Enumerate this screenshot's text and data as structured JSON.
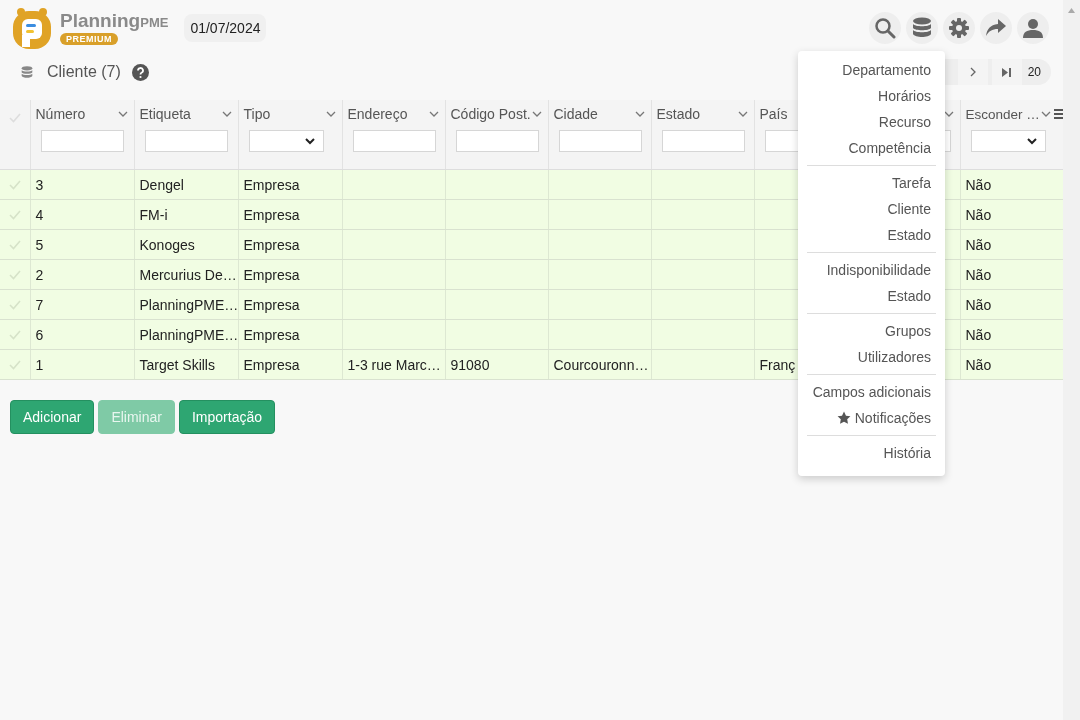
{
  "logo": {
    "name": "Planning",
    "suffix": "PME",
    "badge": "PREMIUM"
  },
  "date": "01/07/2024",
  "title": {
    "text": "Cliente (7)"
  },
  "pagination": {
    "page_size": "20"
  },
  "table": {
    "columns": [
      {
        "label": "Número",
        "kind": "text",
        "chevron": true
      },
      {
        "label": "Etiqueta",
        "kind": "text",
        "chevron": true
      },
      {
        "label": "Tipo",
        "kind": "select",
        "chevron": true
      },
      {
        "label": "Endereço",
        "kind": "text",
        "chevron": true
      },
      {
        "label": "Código Post.",
        "kind": "text",
        "chevron": true
      },
      {
        "label": "Cidade",
        "kind": "text",
        "chevron": true
      },
      {
        "label": "Estado",
        "kind": "text",
        "chevron": true
      },
      {
        "label": "País",
        "kind": "text",
        "chevron": false
      },
      {
        "kind": "text",
        "chevron": true
      },
      {
        "label": "Esconder …",
        "kind": "select",
        "chevron": true
      }
    ],
    "rows": [
      [
        "3",
        "Dengel",
        "Empresa",
        "",
        "",
        "",
        "",
        "",
        "",
        "Não"
      ],
      [
        "4",
        "FM-i",
        "Empresa",
        "",
        "",
        "",
        "",
        "",
        "",
        "Não"
      ],
      [
        "5",
        "Konoges",
        "Empresa",
        "",
        "",
        "",
        "",
        "",
        "",
        "Não"
      ],
      [
        "2",
        "Mercurius De…",
        "Empresa",
        "",
        "",
        "",
        "",
        "",
        "",
        "Não"
      ],
      [
        "7",
        "PlanningPME…",
        "Empresa",
        "",
        "",
        "",
        "",
        "",
        "",
        "Não"
      ],
      [
        "6",
        "PlanningPME…",
        "Empresa",
        "",
        "",
        "",
        "",
        "",
        "",
        "Não"
      ],
      [
        "1",
        "Target Skills",
        "Empresa",
        "1-3 rue Marc…",
        "91080",
        "Courcouronn…",
        "",
        "Franç",
        "",
        "Não"
      ]
    ]
  },
  "buttons": [
    {
      "label": "Adicionar",
      "disabled": false
    },
    {
      "label": "Eliminar",
      "disabled": true
    },
    {
      "label": "Importação",
      "disabled": false
    }
  ],
  "menu": {
    "groups": [
      [
        {
          "label": "Departamento",
          "kind": "plain"
        },
        {
          "label": "Horários",
          "kind": "plain"
        },
        {
          "label": "Recurso",
          "kind": "plain"
        },
        {
          "label": "Competência",
          "kind": "plain"
        }
      ],
      [
        {
          "label": "Tarefa",
          "kind": "plain"
        },
        {
          "label": "Cliente",
          "kind": "plain"
        },
        {
          "label": "Estado",
          "kind": "plain"
        }
      ],
      [
        {
          "label": "Indisponibilidade",
          "kind": "plain"
        },
        {
          "label": "Estado",
          "kind": "plain"
        }
      ],
      [
        {
          "label": "Grupos",
          "kind": "plain"
        },
        {
          "label": "Utilizadores",
          "kind": "plain"
        }
      ],
      [
        {
          "label": "Campos adicionais",
          "kind": "plain"
        },
        {
          "label": "Notificações",
          "kind": "starred"
        }
      ],
      [
        {
          "label": "História",
          "kind": "plain"
        }
      ]
    ]
  }
}
